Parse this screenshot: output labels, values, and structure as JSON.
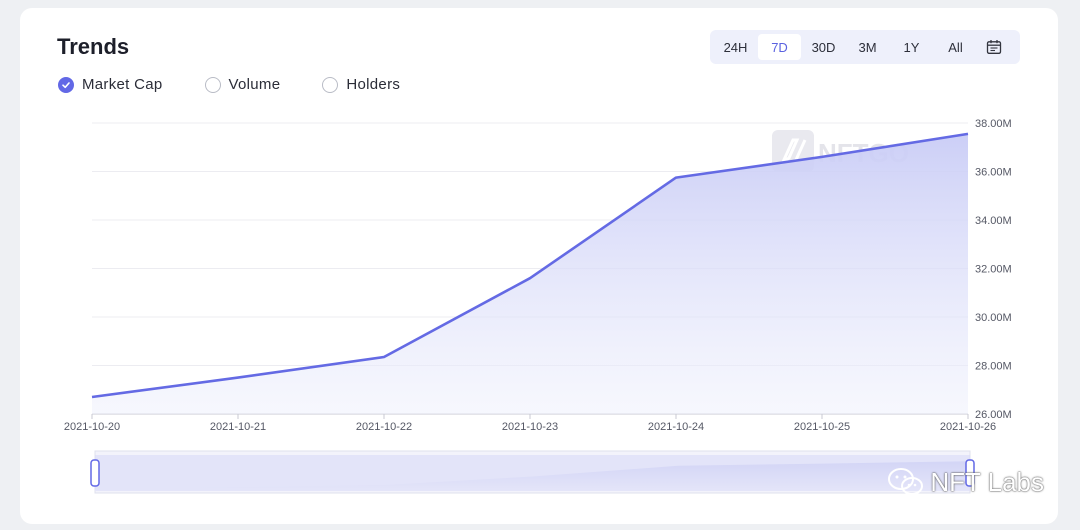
{
  "card": {
    "title": "Trends",
    "toggles": [
      {
        "label": "Market Cap",
        "checked": true
      },
      {
        "label": "Volume",
        "checked": false
      },
      {
        "label": "Holders",
        "checked": false
      }
    ],
    "ranges": [
      "24H",
      "7D",
      "30D",
      "3M",
      "1Y",
      "All"
    ],
    "active_range": "7D"
  },
  "brand_watermark": "NFTGO",
  "corner_watermark": "NFT Labs",
  "colors": {
    "accent": "#6268e6",
    "line": "#646ae4",
    "fill_top": "#cfd1f7",
    "grid": "#ececf1"
  },
  "chart_data": {
    "type": "area",
    "title": "",
    "xlabel": "",
    "ylabel": "",
    "x": [
      "2021-10-20",
      "2021-10-21",
      "2021-10-22",
      "2021-10-23",
      "2021-10-24",
      "2021-10-25",
      "2021-10-26"
    ],
    "series": [
      {
        "name": "Market Cap",
        "values": [
          26.7,
          27.5,
          28.35,
          31.6,
          35.75,
          36.6,
          37.55
        ]
      }
    ],
    "ylim": [
      26,
      38
    ],
    "y_ticks": [
      {
        "value": 38,
        "label": "38.00M"
      },
      {
        "value": 36,
        "label": "36.00M"
      },
      {
        "value": 34,
        "label": "34.00M"
      },
      {
        "value": 32,
        "label": "32.00M"
      },
      {
        "value": 30,
        "label": "30.00M"
      },
      {
        "value": 28,
        "label": "28.00M"
      },
      {
        "value": 26,
        "label": "26.00M"
      }
    ],
    "y_unit": "M",
    "grid": true,
    "legend": "none",
    "navigator": true
  }
}
